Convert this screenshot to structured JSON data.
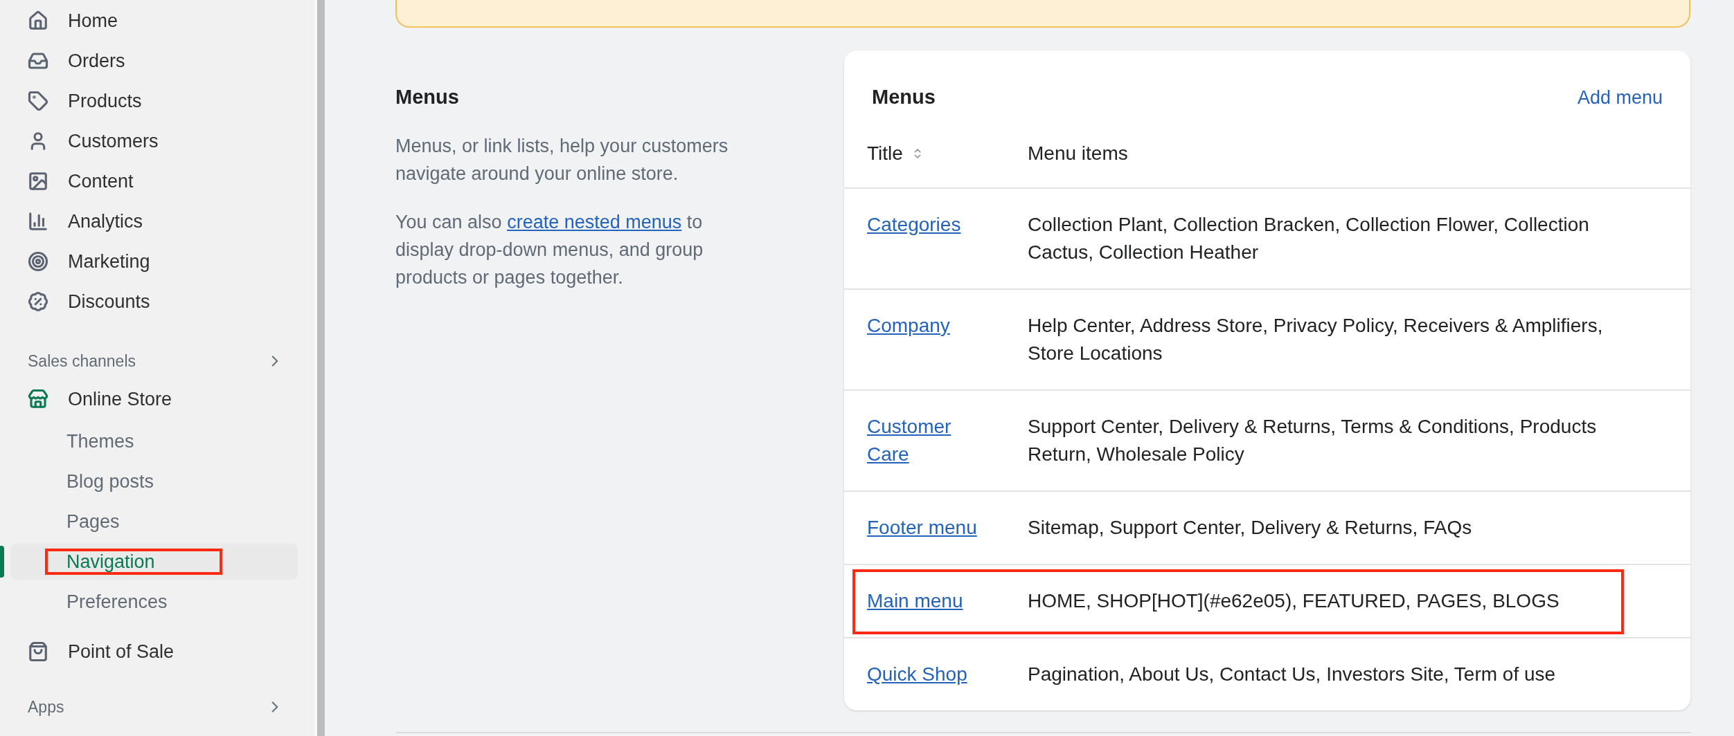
{
  "sidebar": {
    "items": [
      {
        "label": "Home",
        "selected": false
      },
      {
        "label": "Orders",
        "selected": false
      },
      {
        "label": "Products",
        "selected": false
      },
      {
        "label": "Customers",
        "selected": false
      },
      {
        "label": "Content",
        "selected": false
      },
      {
        "label": "Analytics",
        "selected": false
      },
      {
        "label": "Marketing",
        "selected": false
      },
      {
        "label": "Discounts",
        "selected": false
      }
    ],
    "sales_channels": {
      "label": "Sales channels"
    },
    "online_store": {
      "label": "Online Store",
      "children": [
        {
          "label": "Themes",
          "selected": false,
          "highlighted": false
        },
        {
          "label": "Blog posts",
          "selected": false,
          "highlighted": false
        },
        {
          "label": "Pages",
          "selected": false,
          "highlighted": false
        },
        {
          "label": "Navigation",
          "selected": true,
          "highlighted": true
        },
        {
          "label": "Preferences",
          "selected": false,
          "highlighted": false
        }
      ]
    },
    "point_of_sale": {
      "label": "Point of Sale"
    },
    "apps": {
      "label": "Apps"
    }
  },
  "section": {
    "title": "Menus",
    "description": "Menus, or link lists, help your customers navigate around your online store.",
    "note_before": "You can also ",
    "note_link": "create nested menus",
    "note_after": " to display drop-down menus, and group products or pages together."
  },
  "card": {
    "title": "Menus",
    "action": "Add menu",
    "columns": [
      "Title",
      "Menu items"
    ],
    "rows": [
      {
        "title": "Categories",
        "items": "Collection Plant, Collection Bracken, Collection Flower, Collection Cactus, Collection Heather",
        "highlighted": false
      },
      {
        "title": "Company",
        "items": "Help Center, Address Store, Privacy Policy, Receivers & Amplifiers, Store Locations",
        "highlighted": false
      },
      {
        "title": "Customer Care",
        "items": "Support Center, Delivery & Returns, Terms & Conditions, Products Return, Wholesale Policy",
        "highlighted": false
      },
      {
        "title": "Footer menu",
        "items": "Sitemap, Support Center, Delivery & Returns, FAQs",
        "highlighted": false
      },
      {
        "title": "Main menu",
        "items": "HOME, SHOP[HOT](#e62e05), FEATURED, PAGES, BLOGS",
        "highlighted": true
      },
      {
        "title": "Quick Shop",
        "items": "Pagination, About Us, Contact Us, Investors Site, Term of use",
        "highlighted": false
      }
    ]
  }
}
